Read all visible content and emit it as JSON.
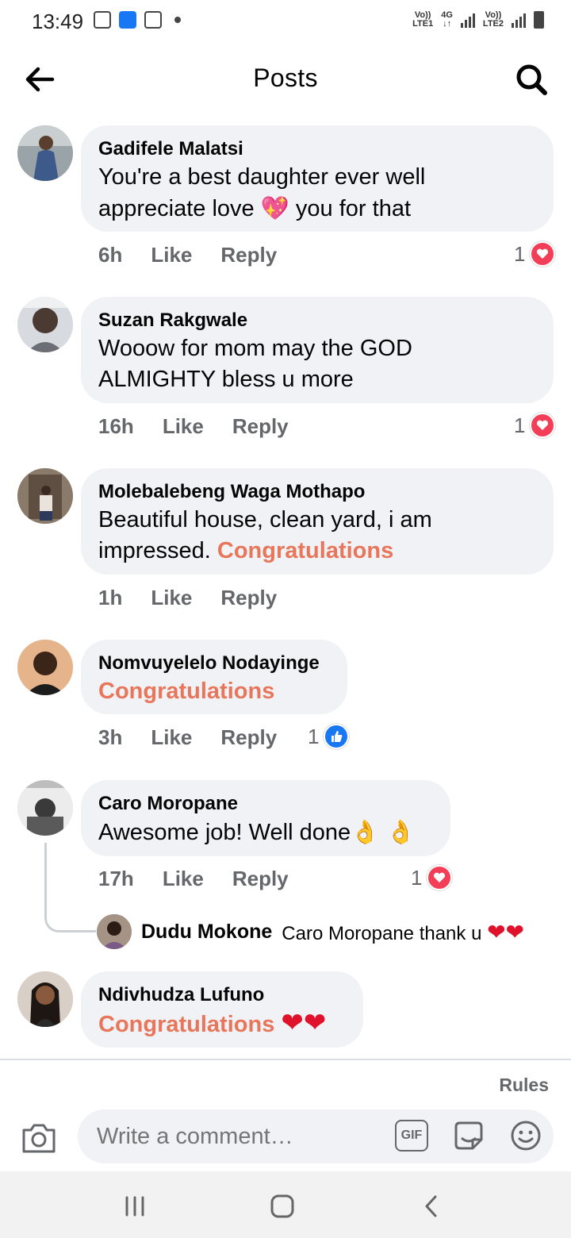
{
  "status_bar": {
    "time": "13:49",
    "net1_top": "Vo))",
    "net1_bottom": "LTE1",
    "net_type_top": "4G",
    "net_type_bottom": "↓↑",
    "net2_top": "Vo))",
    "net2_bottom": "LTE2"
  },
  "header": {
    "title": "Posts",
    "back_icon": "arrow-left-icon",
    "search_icon": "search-icon"
  },
  "actions": {
    "like": "Like",
    "reply": "Reply"
  },
  "comments": [
    {
      "author": "Gadifele Malatsi",
      "line1": "You're a best daughter ever well",
      "line2_a": "appreciate love ",
      "line2_emoji": "💖",
      "line2_b": " you for that",
      "time": "6h",
      "reactions": "1",
      "reaction_type": "heart"
    },
    {
      "author": "Suzan Rakgwale",
      "line1": "Wooow for mom  may the GOD",
      "line2": "ALMIGHTY bless u more",
      "time": "16h",
      "reactions": "1",
      "reaction_type": "heart"
    },
    {
      "author": "Molebalebeng Waga Mothapo",
      "line1": "Beautiful house, clean yard, i am",
      "line2_a": "impressed. ",
      "line2_hl": "Congratulations",
      "time": "1h"
    },
    {
      "author": "Nomvuyelelo Nodayinge",
      "line1_hl": "Congratulations",
      "time": "3h",
      "reactions": "1",
      "reaction_type": "like"
    },
    {
      "author": "Caro Moropane",
      "line1": "Awesome job! Well done",
      "line1_emoji": "👌 👌",
      "time": "17h",
      "reactions": "1",
      "reaction_type": "heart",
      "reply": {
        "author": "Dudu Mokone",
        "text": "Caro Moropane thank u",
        "emoji": "❤❤"
      }
    },
    {
      "author": "Ndivhudza Lufuno",
      "line1_hl": "Congratulations",
      "line1_emoji": "❤❤"
    }
  ],
  "composer": {
    "rules": "Rules",
    "placeholder": "Write a comment…",
    "gif": "GIF",
    "camera_icon": "camera-icon",
    "sticker_icon": "sticker-icon",
    "emoji_icon": "emoji-icon"
  },
  "colors": {
    "highlight": "#e8765b",
    "bubble": "#f0f2f5",
    "meta": "#65676b",
    "heart": "#f33e58",
    "like": "#1877f2"
  }
}
